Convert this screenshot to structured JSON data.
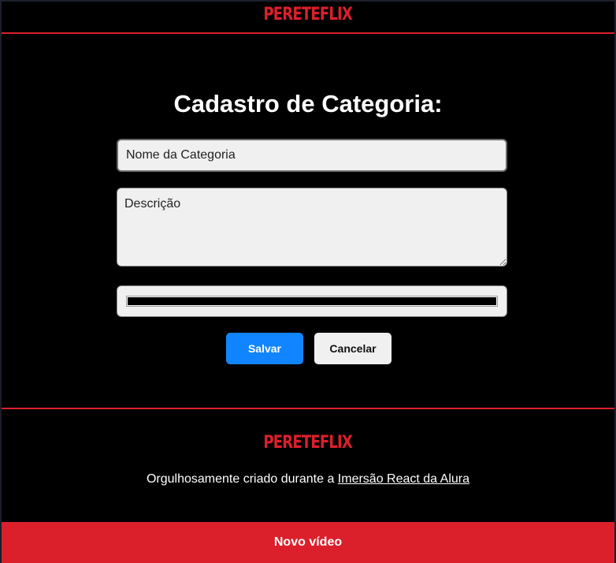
{
  "header": {
    "logo_text": "PERETEFLIX"
  },
  "form": {
    "title": "Cadastro de Categoria:",
    "name_placeholder": "Nome da Categoria",
    "description_placeholder": "Descrição",
    "color_value": "#000000",
    "save_label": "Salvar",
    "cancel_label": "Cancelar"
  },
  "footer": {
    "logo_text": "PERETEFLIX",
    "credit_prefix": "Orgulhosamente criado durante a ",
    "credit_link": "Imersão React da Alura"
  },
  "bottom_bar": {
    "label": "Novo vídeo"
  },
  "colors": {
    "brand_red": "#db202c",
    "primary_blue": "#1185ff",
    "background": "#000000",
    "field_bg": "#f0f0f0"
  }
}
